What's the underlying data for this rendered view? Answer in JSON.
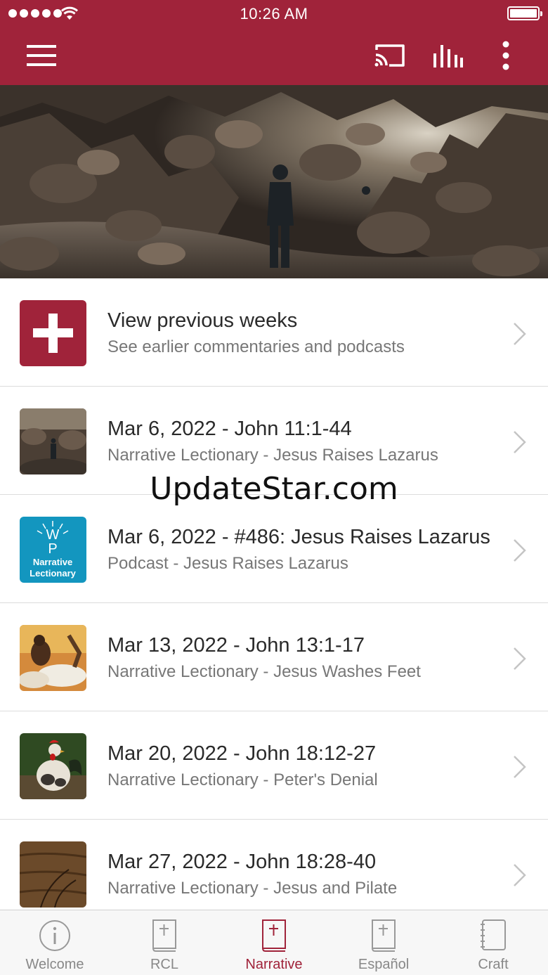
{
  "status_bar": {
    "time": "10:26 AM"
  },
  "app_bar": {
    "menu_icon": "hamburger-icon",
    "cast_icon": "cast-icon",
    "audio_icon": "equalizer-bars-icon",
    "more_icon": "more-vertical-icon"
  },
  "colors": {
    "brand": "#a0233a",
    "active_tab": "#a0233a",
    "inactive_tab": "#888888"
  },
  "list": {
    "items": [
      {
        "title": "View previous weeks",
        "subtitle": "See earlier commentaries and podcasts",
        "thumb": "plus-icon"
      },
      {
        "title": "Mar 6, 2022 - John 11:1-44",
        "subtitle": "Narrative Lectionary - Jesus Raises Lazarus",
        "thumb": "cave-photo"
      },
      {
        "title": "Mar 6, 2022 - #486: Jesus Raises Lazarus",
        "subtitle": "Podcast - Jesus Raises Lazarus",
        "thumb": "podcast-logo",
        "logo_lines": [
          "W",
          "P",
          "Narrative",
          "Lectionary"
        ]
      },
      {
        "title": "Mar 13, 2022 - John 13:1-17",
        "subtitle": "Narrative Lectionary - Jesus Washes Feet",
        "thumb": "painting-photo"
      },
      {
        "title": "Mar 20, 2022 - John 18:12-27",
        "subtitle": "Narrative Lectionary - Peter's Denial",
        "thumb": "rooster-photo"
      },
      {
        "title": "Mar 27, 2022 - John 18:28-40",
        "subtitle": "Narrative Lectionary - Jesus and Pilate",
        "thumb": "wood-photo"
      }
    ]
  },
  "watermark": "UpdateStar.com",
  "tabs": [
    {
      "label": "Welcome",
      "icon": "info-icon",
      "active": false
    },
    {
      "label": "RCL",
      "icon": "book-cross-icon",
      "active": false
    },
    {
      "label": "Narrative",
      "icon": "book-cross-icon",
      "active": true
    },
    {
      "label": "Español",
      "icon": "book-cross-icon",
      "active": false
    },
    {
      "label": "Craft",
      "icon": "notebook-icon",
      "active": false
    }
  ]
}
